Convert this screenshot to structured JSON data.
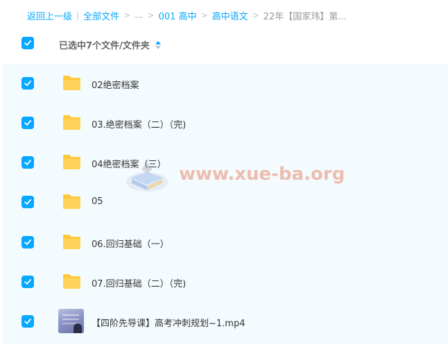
{
  "breadcrumb": {
    "back": "返回上一级",
    "all_files": "全部文件",
    "ellipsis": "...",
    "level1": "001 高中",
    "level2": "高中语文",
    "current": "22年【国家玮】第..."
  },
  "header": {
    "selected_text": "已选中7个文件/文件夹"
  },
  "files": [
    {
      "name": "02绝密档案",
      "type": "folder",
      "checked": true
    },
    {
      "name": "03.绝密档案（二）（完)",
      "type": "folder",
      "checked": true
    },
    {
      "name": "04绝密档案（三）",
      "type": "folder",
      "checked": true
    },
    {
      "name": "05",
      "type": "folder",
      "checked": true
    },
    {
      "name": "06.回归基础（一）",
      "type": "folder",
      "checked": true
    },
    {
      "name": "07.回归基础（二）（完)",
      "type": "folder",
      "checked": true
    },
    {
      "name": "【四阶先导课】高考冲刺规划~1.mp4",
      "type": "video",
      "checked": true
    }
  ],
  "watermark": {
    "text": "www.xue-ba.org"
  },
  "colors": {
    "accent": "#06a7ff",
    "folder": "#ffc93c",
    "list_bg": "#f4fbff"
  }
}
